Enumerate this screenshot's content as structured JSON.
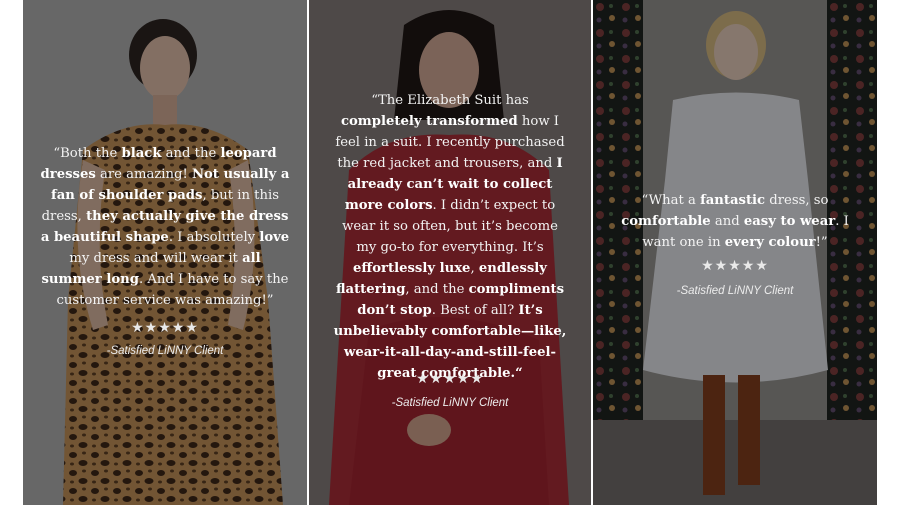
{
  "testimonials": [
    {
      "segments": [
        {
          "t": "“Both the ",
          "b": false
        },
        {
          "t": "black",
          "b": true
        },
        {
          "t": " and the ",
          "b": false
        },
        {
          "t": "leopard dresses",
          "b": true
        },
        {
          "t": " are amazing! ",
          "b": false
        },
        {
          "t": "Not usually a fan of shoulder pads",
          "b": true
        },
        {
          "t": ", but in this dress, ",
          "b": false
        },
        {
          "t": "they actually give the dress a beautiful shape",
          "b": true
        },
        {
          "t": ". I absolutely ",
          "b": false
        },
        {
          "t": "love",
          "b": true
        },
        {
          "t": " my dress and will wear it ",
          "b": false
        },
        {
          "t": "all summer long",
          "b": true
        },
        {
          "t": ". And I have to say the customer service was amazing!”",
          "b": false
        }
      ],
      "stars": "★★★★★",
      "client": "-Satisfied LiNNY Client"
    },
    {
      "segments": [
        {
          "t": "“The Elizabeth Suit has ",
          "b": false
        },
        {
          "t": "completely transformed",
          "b": true
        },
        {
          "t": " how I feel in a suit. I recently purchased the red jacket and trousers, and ",
          "b": false
        },
        {
          "t": "I already can’t wait to collect more colors",
          "b": true
        },
        {
          "t": ". I didn’t expect to wear it so often, but it’s become my go-to for everything. It’s ",
          "b": false
        },
        {
          "t": "effortlessly luxe",
          "b": true
        },
        {
          "t": ", ",
          "b": false
        },
        {
          "t": "endlessly flattering",
          "b": true
        },
        {
          "t": ", and the ",
          "b": false
        },
        {
          "t": "compliments don’t stop",
          "b": true
        },
        {
          "t": ". Best of all? ",
          "b": false
        },
        {
          "t": "It’s unbelievably comfortable—like, wear-it-all-day-and-still-feel-great comfortable.“",
          "b": true
        }
      ],
      "stars": "★★★★★",
      "client": "-Satisfied LiNNY Client"
    },
    {
      "segments": [
        {
          "t": "“What a ",
          "b": false
        },
        {
          "t": "fantastic",
          "b": true
        },
        {
          "t": " dress, so ",
          "b": false
        },
        {
          "t": "comfortable",
          "b": true
        },
        {
          "t": " and ",
          "b": false
        },
        {
          "t": "easy to wear",
          "b": true
        },
        {
          "t": ". I want one in ",
          "b": false
        },
        {
          "t": "every colour",
          "b": true
        },
        {
          "t": "!”",
          "b": false
        }
      ],
      "stars": "★★★★★",
      "client": "-Satisfied LiNNY Client"
    }
  ]
}
